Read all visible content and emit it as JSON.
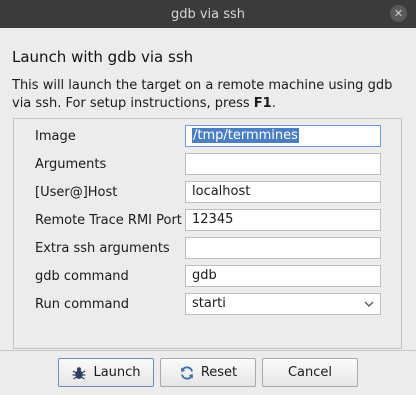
{
  "window": {
    "title": "gdb via ssh",
    "close_glyph": "✕"
  },
  "header": {
    "heading": "Launch with gdb via ssh",
    "description_before": "This will launch the target on a remote machine using gdb via ssh. For setup instructions, press ",
    "description_key": "F1",
    "description_after": "."
  },
  "form": {
    "rows": [
      {
        "label": "Image",
        "value": "/tmp/termmines"
      },
      {
        "label": "Arguments",
        "value": ""
      },
      {
        "label": "[User@]Host",
        "value": "localhost"
      },
      {
        "label": "Remote Trace RMI Port",
        "value": "12345"
      },
      {
        "label": "Extra ssh arguments",
        "value": ""
      },
      {
        "label": "gdb command",
        "value": "gdb"
      },
      {
        "label": "Run command",
        "value": "starti"
      }
    ]
  },
  "buttons": {
    "launch": "Launch",
    "reset": "Reset",
    "cancel": "Cancel"
  },
  "icons": {
    "launch": "bug-icon",
    "reset": "refresh-icon",
    "dropdown": "chevron-down-icon",
    "close": "close-icon"
  },
  "colors": {
    "titlebar": "#3b3b3b",
    "selection": "#4a7fc1",
    "focus_border": "#6b9fd6"
  }
}
